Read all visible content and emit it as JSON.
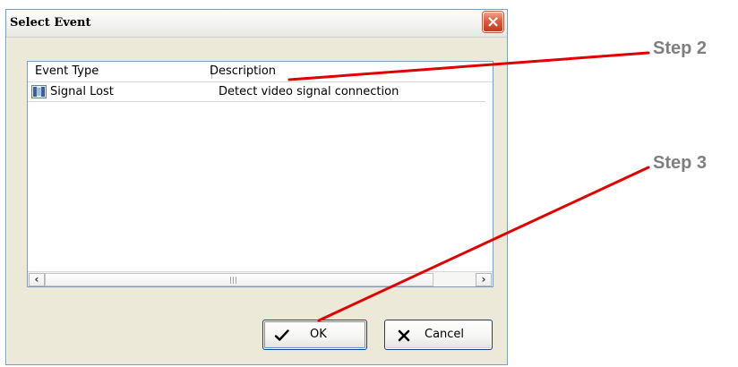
{
  "dialog": {
    "title": "Select Event",
    "close_icon": "close-icon"
  },
  "listview": {
    "columns": [
      {
        "label": "Event Type"
      },
      {
        "label": "Description"
      }
    ],
    "rows": [
      {
        "icon": "signal-lost-icon",
        "event_type": "Signal Lost",
        "description": "Detect video signal connection"
      }
    ],
    "scrollbar": {
      "left_icon": "scroll-left-icon",
      "right_icon": "scroll-right-icon"
    }
  },
  "buttons": {
    "ok": {
      "label": "OK",
      "icon": "check-icon"
    },
    "cancel": {
      "label": "Cancel",
      "icon": "x-icon"
    }
  },
  "annotations": {
    "step_2": "Step 2",
    "step_3": "Step 3"
  },
  "colors": {
    "accent_red": "#e00000",
    "annotation_gray": "#7f7f7f",
    "window_bg": "#ece9d8",
    "border_blue": "#7f9db9"
  }
}
